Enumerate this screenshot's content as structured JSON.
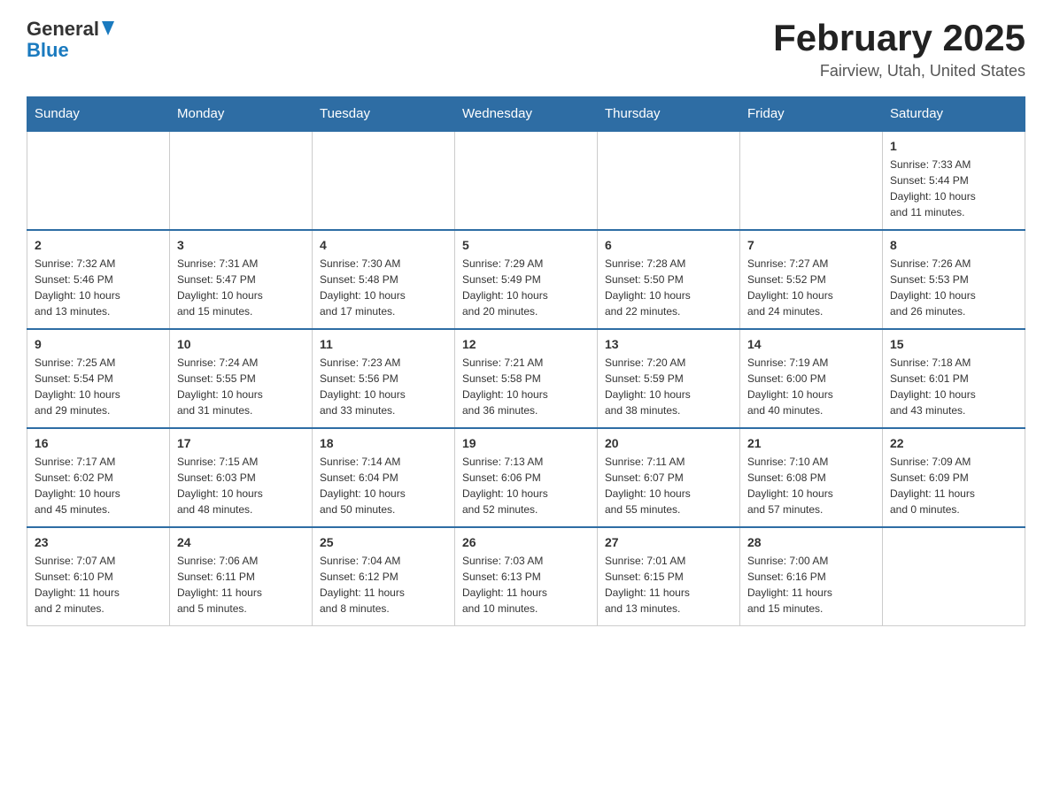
{
  "header": {
    "logo_general": "General",
    "logo_blue": "Blue",
    "title": "February 2025",
    "location": "Fairview, Utah, United States"
  },
  "days_of_week": [
    "Sunday",
    "Monday",
    "Tuesday",
    "Wednesday",
    "Thursday",
    "Friday",
    "Saturday"
  ],
  "weeks": [
    {
      "days": [
        {
          "number": "",
          "info": ""
        },
        {
          "number": "",
          "info": ""
        },
        {
          "number": "",
          "info": ""
        },
        {
          "number": "",
          "info": ""
        },
        {
          "number": "",
          "info": ""
        },
        {
          "number": "",
          "info": ""
        },
        {
          "number": "1",
          "info": "Sunrise: 7:33 AM\nSunset: 5:44 PM\nDaylight: 10 hours\nand 11 minutes."
        }
      ]
    },
    {
      "days": [
        {
          "number": "2",
          "info": "Sunrise: 7:32 AM\nSunset: 5:46 PM\nDaylight: 10 hours\nand 13 minutes."
        },
        {
          "number": "3",
          "info": "Sunrise: 7:31 AM\nSunset: 5:47 PM\nDaylight: 10 hours\nand 15 minutes."
        },
        {
          "number": "4",
          "info": "Sunrise: 7:30 AM\nSunset: 5:48 PM\nDaylight: 10 hours\nand 17 minutes."
        },
        {
          "number": "5",
          "info": "Sunrise: 7:29 AM\nSunset: 5:49 PM\nDaylight: 10 hours\nand 20 minutes."
        },
        {
          "number": "6",
          "info": "Sunrise: 7:28 AM\nSunset: 5:50 PM\nDaylight: 10 hours\nand 22 minutes."
        },
        {
          "number": "7",
          "info": "Sunrise: 7:27 AM\nSunset: 5:52 PM\nDaylight: 10 hours\nand 24 minutes."
        },
        {
          "number": "8",
          "info": "Sunrise: 7:26 AM\nSunset: 5:53 PM\nDaylight: 10 hours\nand 26 minutes."
        }
      ]
    },
    {
      "days": [
        {
          "number": "9",
          "info": "Sunrise: 7:25 AM\nSunset: 5:54 PM\nDaylight: 10 hours\nand 29 minutes."
        },
        {
          "number": "10",
          "info": "Sunrise: 7:24 AM\nSunset: 5:55 PM\nDaylight: 10 hours\nand 31 minutes."
        },
        {
          "number": "11",
          "info": "Sunrise: 7:23 AM\nSunset: 5:56 PM\nDaylight: 10 hours\nand 33 minutes."
        },
        {
          "number": "12",
          "info": "Sunrise: 7:21 AM\nSunset: 5:58 PM\nDaylight: 10 hours\nand 36 minutes."
        },
        {
          "number": "13",
          "info": "Sunrise: 7:20 AM\nSunset: 5:59 PM\nDaylight: 10 hours\nand 38 minutes."
        },
        {
          "number": "14",
          "info": "Sunrise: 7:19 AM\nSunset: 6:00 PM\nDaylight: 10 hours\nand 40 minutes."
        },
        {
          "number": "15",
          "info": "Sunrise: 7:18 AM\nSunset: 6:01 PM\nDaylight: 10 hours\nand 43 minutes."
        }
      ]
    },
    {
      "days": [
        {
          "number": "16",
          "info": "Sunrise: 7:17 AM\nSunset: 6:02 PM\nDaylight: 10 hours\nand 45 minutes."
        },
        {
          "number": "17",
          "info": "Sunrise: 7:15 AM\nSunset: 6:03 PM\nDaylight: 10 hours\nand 48 minutes."
        },
        {
          "number": "18",
          "info": "Sunrise: 7:14 AM\nSunset: 6:04 PM\nDaylight: 10 hours\nand 50 minutes."
        },
        {
          "number": "19",
          "info": "Sunrise: 7:13 AM\nSunset: 6:06 PM\nDaylight: 10 hours\nand 52 minutes."
        },
        {
          "number": "20",
          "info": "Sunrise: 7:11 AM\nSunset: 6:07 PM\nDaylight: 10 hours\nand 55 minutes."
        },
        {
          "number": "21",
          "info": "Sunrise: 7:10 AM\nSunset: 6:08 PM\nDaylight: 10 hours\nand 57 minutes."
        },
        {
          "number": "22",
          "info": "Sunrise: 7:09 AM\nSunset: 6:09 PM\nDaylight: 11 hours\nand 0 minutes."
        }
      ]
    },
    {
      "days": [
        {
          "number": "23",
          "info": "Sunrise: 7:07 AM\nSunset: 6:10 PM\nDaylight: 11 hours\nand 2 minutes."
        },
        {
          "number": "24",
          "info": "Sunrise: 7:06 AM\nSunset: 6:11 PM\nDaylight: 11 hours\nand 5 minutes."
        },
        {
          "number": "25",
          "info": "Sunrise: 7:04 AM\nSunset: 6:12 PM\nDaylight: 11 hours\nand 8 minutes."
        },
        {
          "number": "26",
          "info": "Sunrise: 7:03 AM\nSunset: 6:13 PM\nDaylight: 11 hours\nand 10 minutes."
        },
        {
          "number": "27",
          "info": "Sunrise: 7:01 AM\nSunset: 6:15 PM\nDaylight: 11 hours\nand 13 minutes."
        },
        {
          "number": "28",
          "info": "Sunrise: 7:00 AM\nSunset: 6:16 PM\nDaylight: 11 hours\nand 15 minutes."
        },
        {
          "number": "",
          "info": ""
        }
      ]
    }
  ]
}
